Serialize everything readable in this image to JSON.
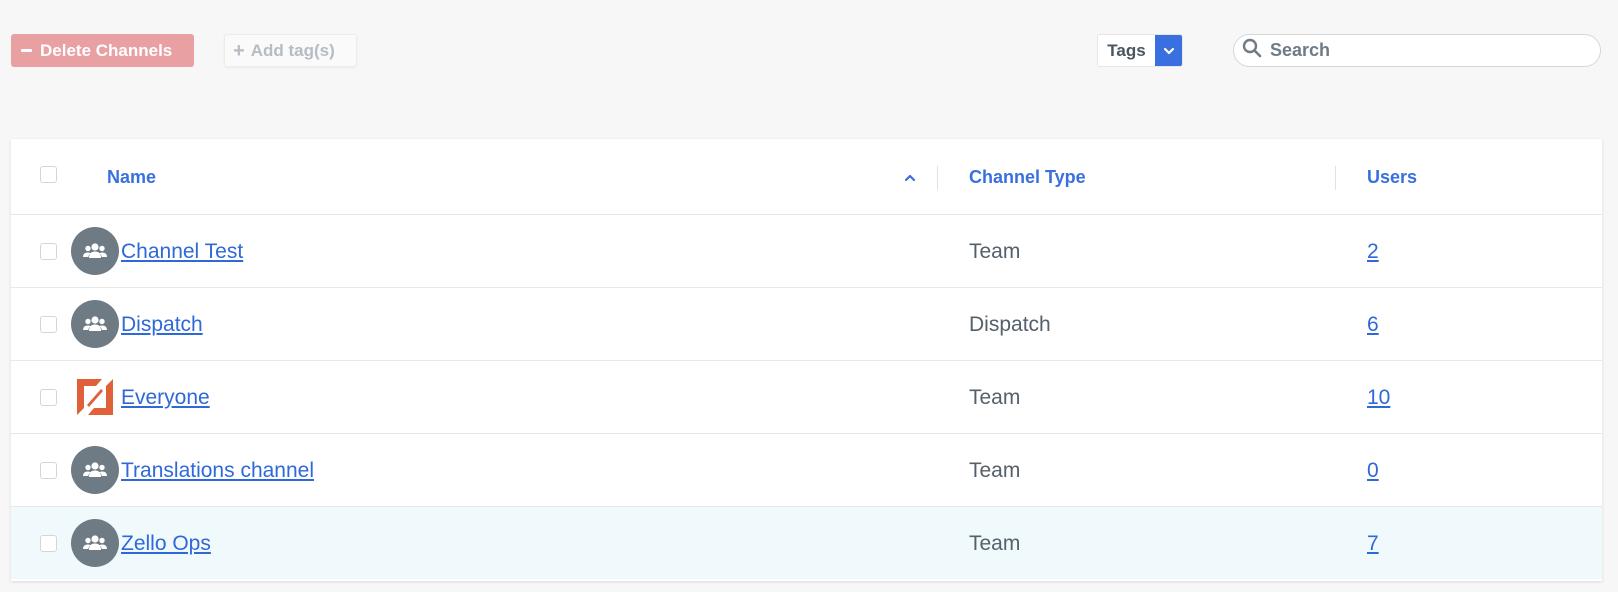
{
  "toolbar": {
    "delete_label": "Delete Channels",
    "add_tag_label": "Add tag(s)",
    "tags_label": "Tags",
    "search_placeholder": "Search"
  },
  "table": {
    "columns": {
      "name": "Name",
      "channel_type": "Channel Type",
      "users": "Users"
    },
    "sort": "ascending",
    "rows": [
      {
        "name": "Channel Test",
        "type": "Team",
        "users": "2",
        "icon": "group-icon"
      },
      {
        "name": "Dispatch",
        "type": "Dispatch",
        "users": "6",
        "icon": "group-icon"
      },
      {
        "name": "Everyone",
        "type": "Team",
        "users": "10",
        "icon": "zello-logo-icon"
      },
      {
        "name": "Translations channel",
        "type": "Team",
        "users": "0",
        "icon": "group-icon"
      },
      {
        "name": "Zello Ops",
        "type": "Team",
        "users": "7",
        "icon": "group-icon"
      }
    ]
  },
  "colors": {
    "accent": "#3a6fe0",
    "link": "#2f68d8",
    "delete_button": "#e8a0a3",
    "avatar": "#6e7a84",
    "logo": "#e0603a",
    "highlight_row": "#f0fafc"
  }
}
